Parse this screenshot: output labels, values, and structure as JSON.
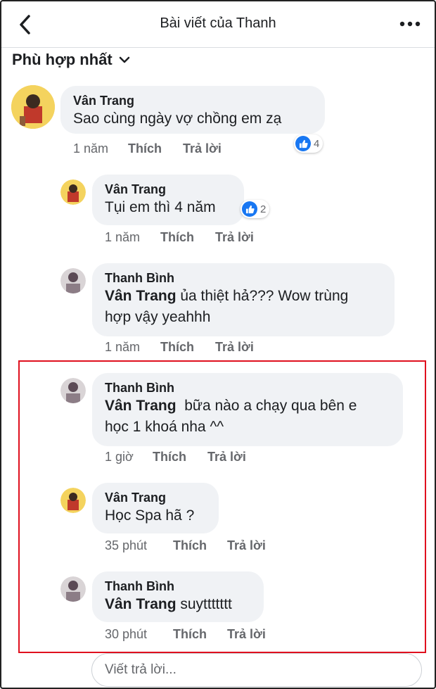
{
  "header": {
    "title": "Bài viết của Thanh",
    "back_icon": "chevron-left-icon",
    "more_icon": "more-horizontal-icon"
  },
  "sort": {
    "label": "Phù hợp nhất",
    "icon": "chevron-down-icon"
  },
  "comments": [
    {
      "author": "Vân Trang",
      "text": "Sao cùng ngày vợ chồng em zạ",
      "time": "1 năm",
      "like": "Thích",
      "reply": "Trả lời",
      "reactions": "4"
    },
    {
      "author": "Vân Trang",
      "text": "Tụi em thì 4 năm",
      "time": "1 năm",
      "like": "Thích",
      "reply": "Trả lời",
      "reactions": "2"
    },
    {
      "author": "Thanh Bình",
      "mention": "Vân Trang",
      "text_line1": " ủa thiệt hả??? Wow trùng",
      "text_line2": "hợp vậy yeahhh",
      "time": "1 năm",
      "like": "Thích",
      "reply": "Trả lời"
    },
    {
      "author": "Thanh Bình",
      "mention": "Vân Trang",
      "text_line1": "  bữa nào a chạy qua bên e",
      "text_line2": "học 1 khoá nha ^^",
      "time": "1 giờ",
      "like": "Thích",
      "reply": "Trả lời"
    },
    {
      "author": "Vân Trang",
      "text": "Học Spa hã ?",
      "time": "35 phút",
      "like": "Thích",
      "reply": "Trả lời"
    },
    {
      "author": "Thanh Bình",
      "mention": "Vân Trang",
      "text": " suyttttttt",
      "time": "30 phút",
      "like": "Thích",
      "reply": "Trả lời"
    }
  ],
  "reply_input": {
    "placeholder": "Viết trả lời..."
  },
  "colors": {
    "accent": "#1877f2",
    "highlight": "#e0101e",
    "bubble": "#f0f2f5"
  }
}
